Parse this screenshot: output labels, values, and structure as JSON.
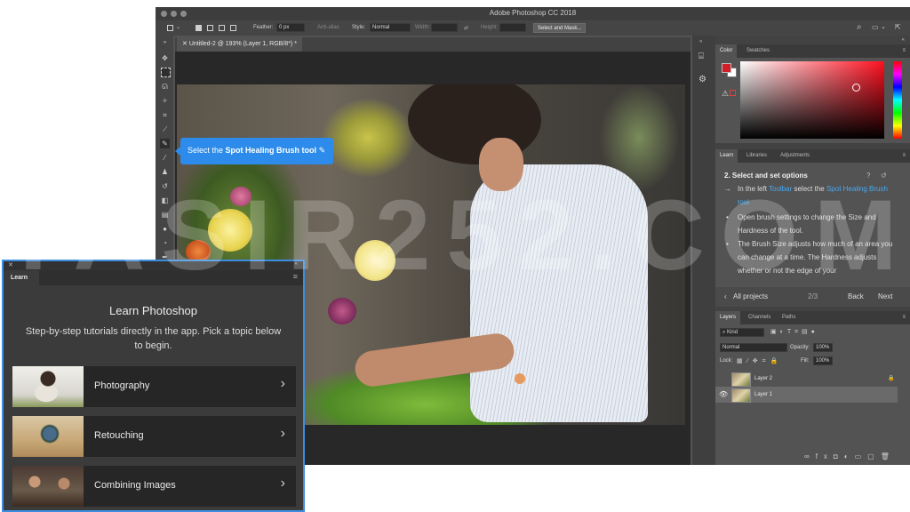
{
  "app": {
    "title": "Adobe Photoshop CC 2018",
    "window_controls": [
      "close",
      "minimize",
      "zoom"
    ]
  },
  "options_bar": {
    "feather_label": "Feather:",
    "feather_value": "0 px",
    "anti_alias_label": "Anti-alias",
    "style_label": "Style:",
    "style_value": "Normal",
    "width_label": "Width:",
    "height_label": "Height:",
    "select_mask_button": "Select and Mask..."
  },
  "document_tab": {
    "label": "Untitled-2 @ 193% (Layer 1, RGB/8*) *"
  },
  "tooltip": {
    "prefix": "Select the",
    "highlight": "Spot Healing Brush tool"
  },
  "tools": [
    "move-icon",
    "marquee-icon",
    "lasso-icon",
    "magic-wand-icon",
    "crop-icon",
    "eyedropper-icon",
    "spot-healing-icon",
    "brush-icon",
    "clone-stamp-icon",
    "history-brush-icon",
    "eraser-icon",
    "gradient-icon",
    "blur-icon",
    "dodge-icon",
    "pen-icon"
  ],
  "color_panel": {
    "tabs": [
      "Color",
      "Swatches"
    ],
    "foreground": "#d21e25",
    "background": "#ffffff"
  },
  "learn_side_panel": {
    "tabs": [
      "Learn",
      "Libraries",
      "Adjustments"
    ],
    "step_title": "2.  Select and set options",
    "step1_a": "In the left",
    "step1_b": "Toolbar",
    "step1_c": "select the",
    "step1_d": "Spot Healing",
    "step1_e": "Brush tool",
    "bullet1": "Open brush settings to change the Size and Hardness of the tool.",
    "bullet2": "The Brush Size adjusts how much of an area you can change at a time. The Hardness adjusts whether or not the edge of your",
    "all_projects": "All projects",
    "page": "2/3",
    "back": "Back",
    "next": "Next"
  },
  "layers_panel": {
    "tabs": [
      "Layers",
      "Channels",
      "Paths"
    ],
    "filter_kind": "Kind",
    "blend_mode": "Normal",
    "opacity_label": "Opacity:",
    "opacity_value": "100%",
    "lock_label": "Lock:",
    "fill_label": "Fill:",
    "fill_value": "100%",
    "layers": [
      {
        "name": "Layer 2",
        "visible": false,
        "locked": true
      },
      {
        "name": "Layer 1",
        "visible": true,
        "locked": false
      }
    ]
  },
  "learn_panel": {
    "tab": "Learn",
    "heading": "Learn Photoshop",
    "subtitle": "Step-by-step tutorials directly in the app. Pick a topic below to begin.",
    "topics": [
      {
        "label": "Photography"
      },
      {
        "label": "Retouching"
      },
      {
        "label": "Combining Images"
      }
    ]
  },
  "watermark": "YASIR252.COM",
  "colors": {
    "accent": "#2d8ceb",
    "link": "#4aa8ef",
    "panel_border": "#3d8de0"
  }
}
